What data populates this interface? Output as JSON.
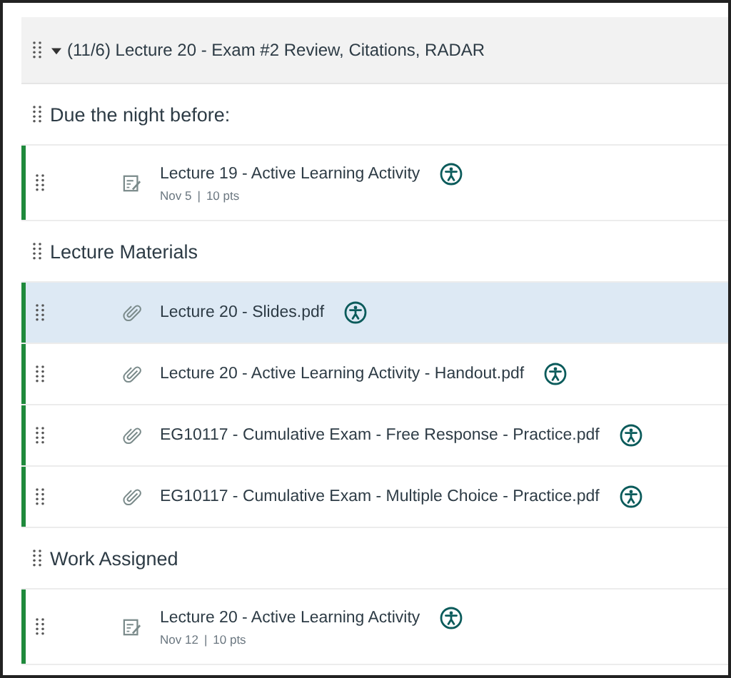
{
  "module": {
    "title": "(11/6) Lecture 20 - Exam #2 Review, Citations, RADAR",
    "expanded": true
  },
  "items": [
    {
      "kind": "subheader",
      "title": "Due the night before:"
    },
    {
      "kind": "assignment",
      "title": "Lecture 19 - Active Learning Activity",
      "date": "Nov 5",
      "separator": "|",
      "points": "10 pts",
      "published": true,
      "selected": false
    },
    {
      "kind": "subheader",
      "title": "Lecture Materials"
    },
    {
      "kind": "file",
      "title": "Lecture 20 - Slides.pdf",
      "published": true,
      "selected": true
    },
    {
      "kind": "file",
      "title": "Lecture 20 - Active Learning Activity - Handout.pdf",
      "published": true,
      "selected": false
    },
    {
      "kind": "file",
      "title": "EG10117 - Cumulative Exam - Free Response - Practice.pdf",
      "published": true,
      "selected": false
    },
    {
      "kind": "file",
      "title": "EG10117 - Cumulative Exam - Multiple Choice - Practice.pdf",
      "published": true,
      "selected": false
    },
    {
      "kind": "subheader",
      "title": "Work Assigned"
    },
    {
      "kind": "assignment",
      "title": "Lecture 20 - Active Learning Activity",
      "date": "Nov 12",
      "separator": "|",
      "points": "10 pts",
      "published": true,
      "selected": false
    }
  ]
}
